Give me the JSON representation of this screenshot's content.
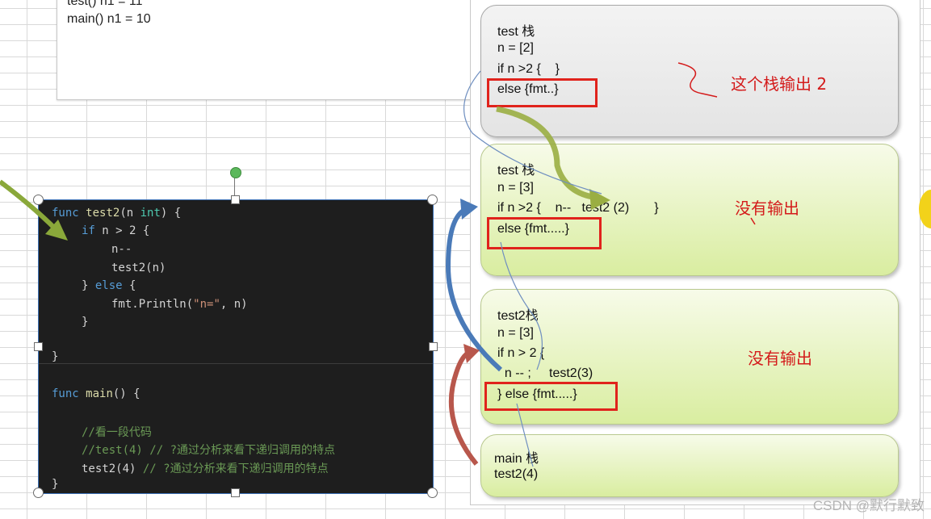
{
  "output": {
    "line1": "test() n1 = 11",
    "line2": "main() n1 = 10"
  },
  "stacks": {
    "s1": {
      "title": "test 栈",
      "l1": "n = [2]",
      "l2": "if n >2 {    }",
      "l3": "else {fmt..}"
    },
    "s2": {
      "title": "test 栈",
      "l1": "n = [3]",
      "l2": "if n >2 {    n--   test2 (2)       }",
      "l3": "else {fmt.....}"
    },
    "s3": {
      "title": "test2栈",
      "l1": "n = [3]",
      "l2": "if n > 2 {",
      "l3": "  n -- ;     test2(3)",
      "l4": "} else {fmt.....}"
    },
    "s4": {
      "title": "main 栈",
      "l1": "test2(4)"
    }
  },
  "notes": {
    "n1": "这个栈输出 2",
    "n2": "没有输出",
    "n3": "没有输出"
  },
  "code": {
    "l1_kw": "func",
    "l1_fn": "test2",
    "l1_a": "(n ",
    "l1_ty": "int",
    "l1_b": ") {",
    "l2_kw": "if",
    "l2_t": " n > 2 {",
    "l3": "n--",
    "l4": "test2(n)",
    "l5_a": "} ",
    "l5_kw": "else",
    "l5_b": " {",
    "l6_a": "fmt.Println(",
    "l6_str": "\"n=\"",
    "l6_b": ", n)",
    "l7": "}",
    "l8": "}",
    "l9_kw": "func",
    "l9_fn": "main",
    "l9_b": "() {",
    "l10": "//看一段代码",
    "l11": "//test(4) // ?通过分析来看下递归调用的特点",
    "l12_a": "test2(4)",
    "l12_cm": " // ?通过分析来看下递归调用的特点",
    "l13": "}"
  },
  "watermark": "CSDN @默行默致",
  "colors": {
    "red": "#e0231c",
    "green_arrow": "#8aa83a",
    "blue_arrow": "#4a7ab8",
    "red_arrow": "#b8574c"
  }
}
